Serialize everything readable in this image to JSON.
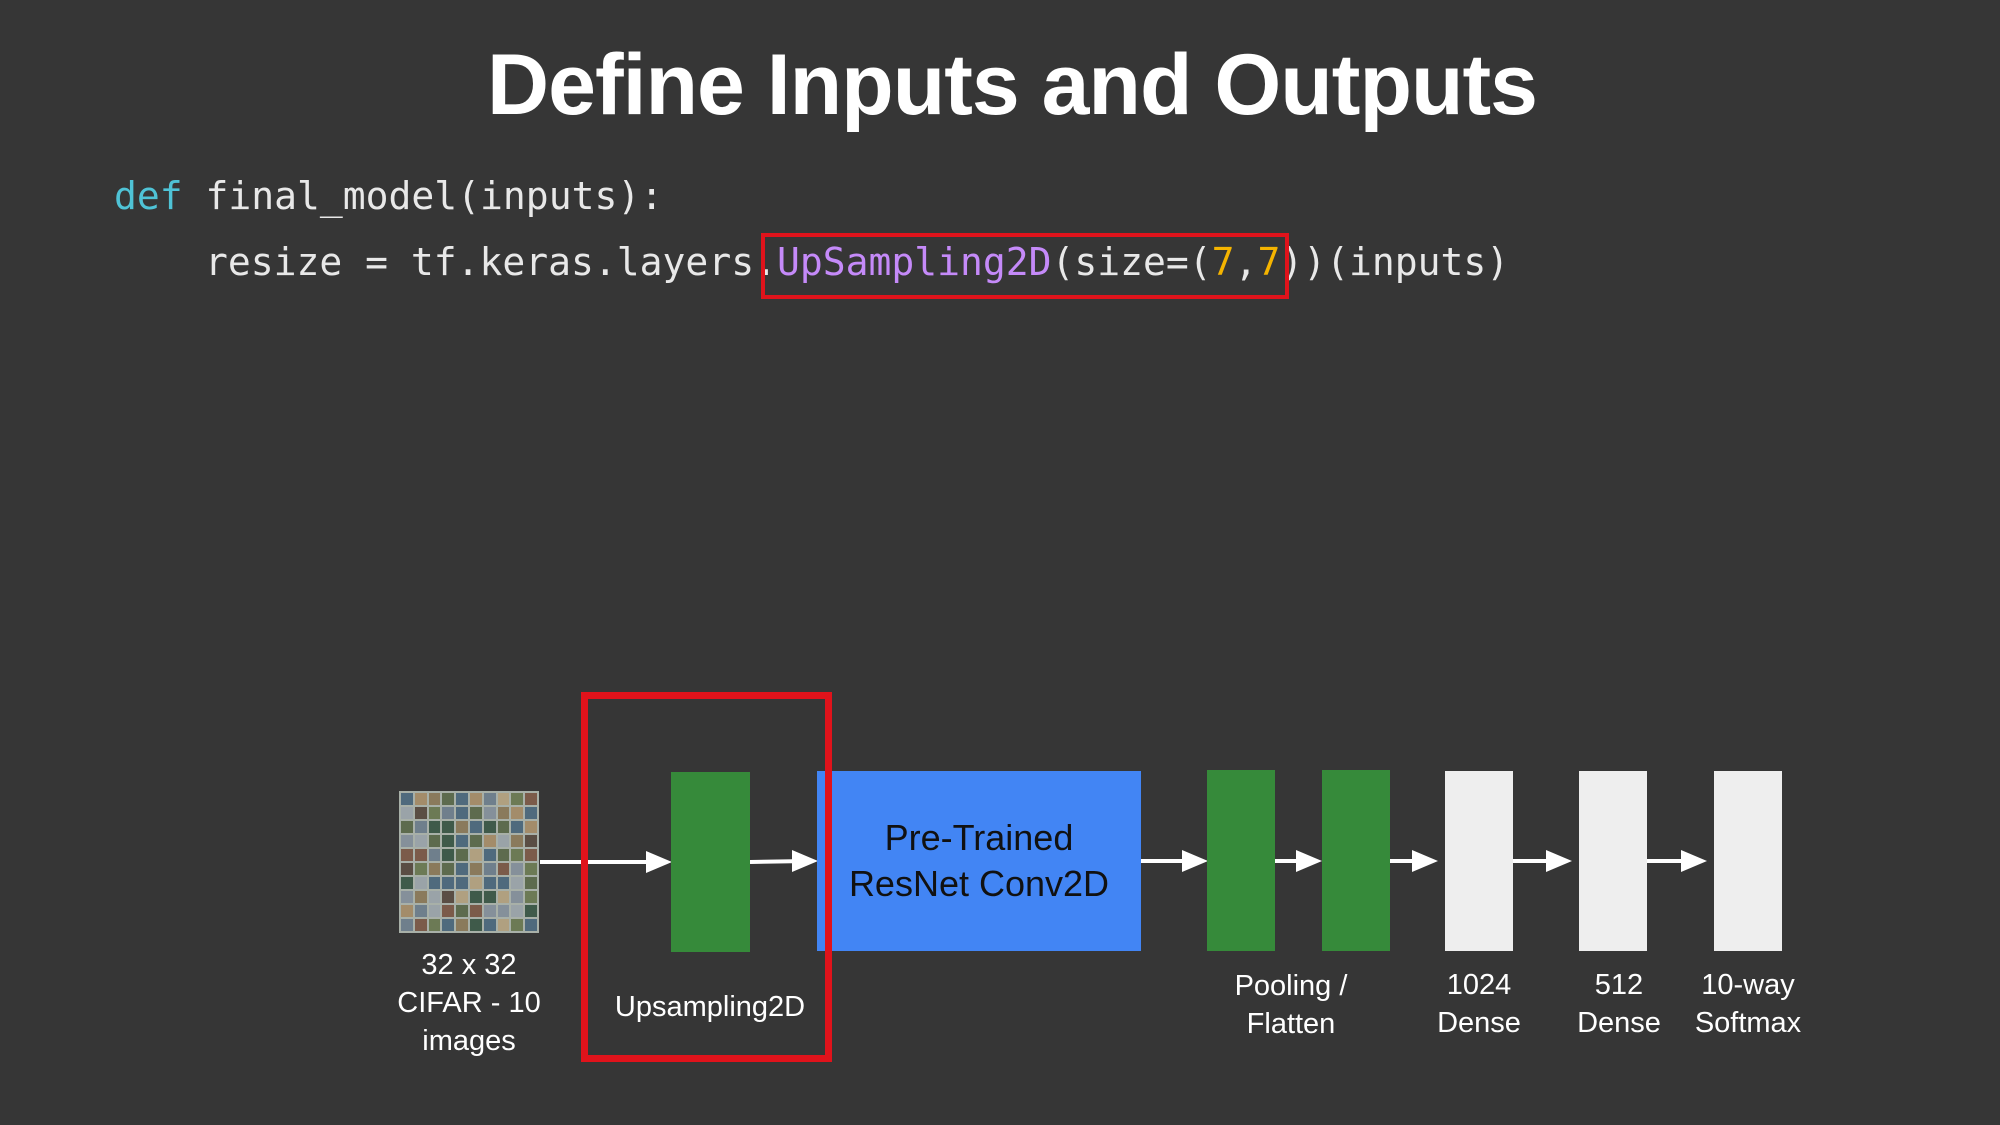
{
  "slide": {
    "title": "Define Inputs and Outputs"
  },
  "code": {
    "line1_keyword": "def",
    "line1_rest": " final_model(inputs):",
    "line2_prefix": "resize = tf.keras.layers.",
    "line2_function": "UpSampling2D",
    "line2_args_open": "(size=(",
    "line2_num1": "7",
    "line2_comma": ",",
    "line2_num2": "7",
    "line2_suffix": "))(inputs)"
  },
  "diagram": {
    "input_label": "32 x 32\nCIFAR - 10\nimages",
    "upsampling_label": "Upsampling2D",
    "resnet_label": "Pre-Trained\nResNet Conv2D",
    "pooling_label": "Pooling /\nFlatten",
    "dense1024_label": "1024\nDense",
    "dense512_label": "512\nDense",
    "softmax_label": "10-way\nSoftmax"
  },
  "colors": {
    "background": "#363636",
    "highlight_red": "#e0131b",
    "layer_green": "#368a3a",
    "resnet_blue": "#4285f4",
    "dense_white": "#eeeeee",
    "keyword_cyan": "#4fc3d6",
    "function_purple": "#c58af9",
    "number_yellow": "#f5b400"
  }
}
